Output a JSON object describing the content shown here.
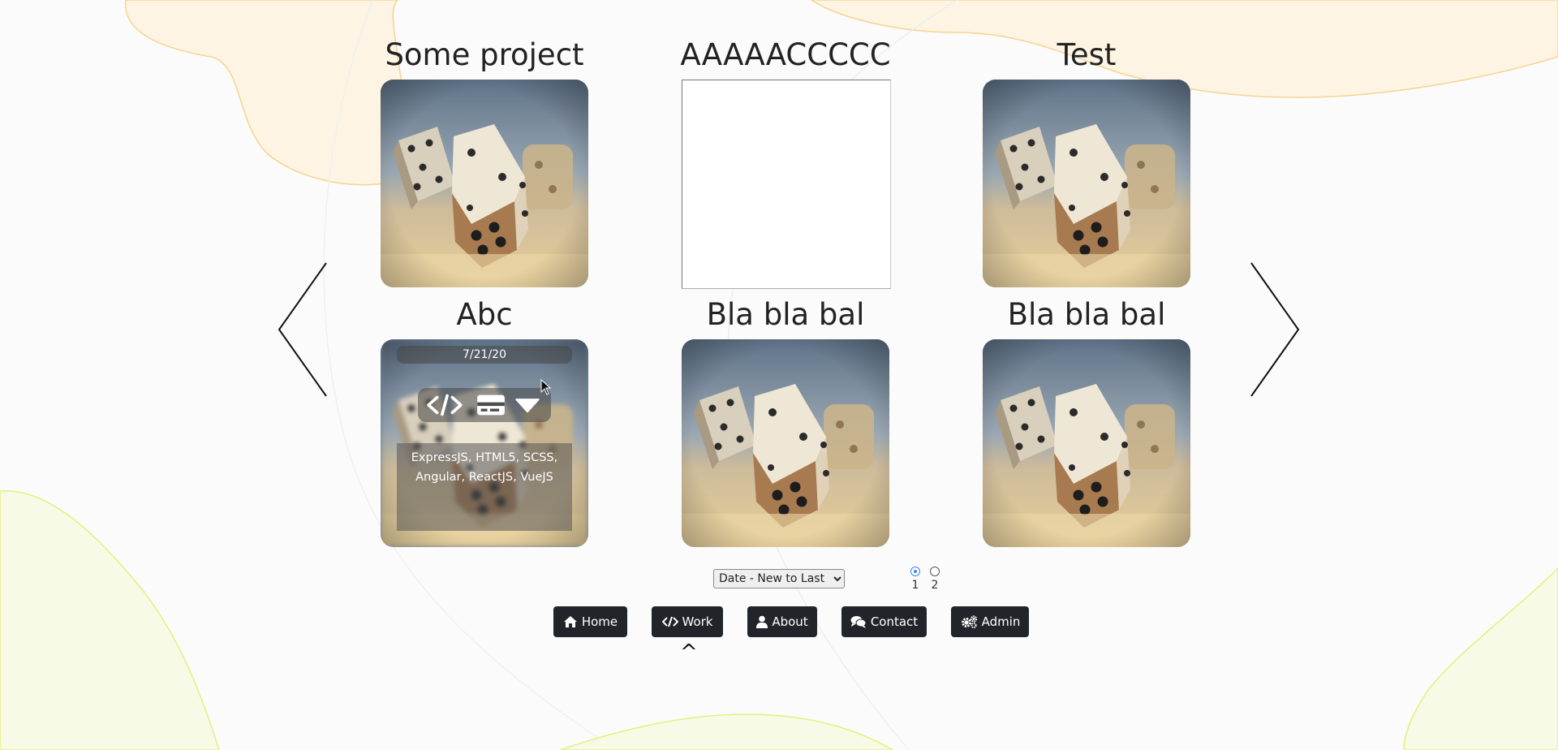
{
  "projects": [
    {
      "title": "Some project",
      "image": "dice-photo"
    },
    {
      "title": "AAAAACCCCC",
      "image": "blank"
    },
    {
      "title": "Test",
      "image": "dice-photo"
    },
    {
      "title": "Abc",
      "image": "dice-photo",
      "date": "7/21/20",
      "tech": "ExpressJS, HTML5, SCSS, Angular, ReactJS, VueJS",
      "hovered": true
    },
    {
      "title": "Bla bla bal",
      "image": "dice-photo"
    },
    {
      "title": "Bla bla bal",
      "image": "dice-photo"
    }
  ],
  "overlay_icons": [
    "code-icon",
    "card-icon",
    "caret-down-icon"
  ],
  "sort": {
    "selected": "Date - New to Last"
  },
  "pagination": {
    "pages": [
      "1",
      "2"
    ],
    "current": "1"
  },
  "nav": {
    "home": "Home",
    "work": "Work",
    "about": "About",
    "contact": "Contact",
    "admin": "Admin",
    "active_marker": "^"
  },
  "colors": {
    "button_bg": "#212529",
    "accent": "#3b82f6",
    "blob_orange": "#fdf4e3",
    "blob_green": "#f7fae6"
  }
}
